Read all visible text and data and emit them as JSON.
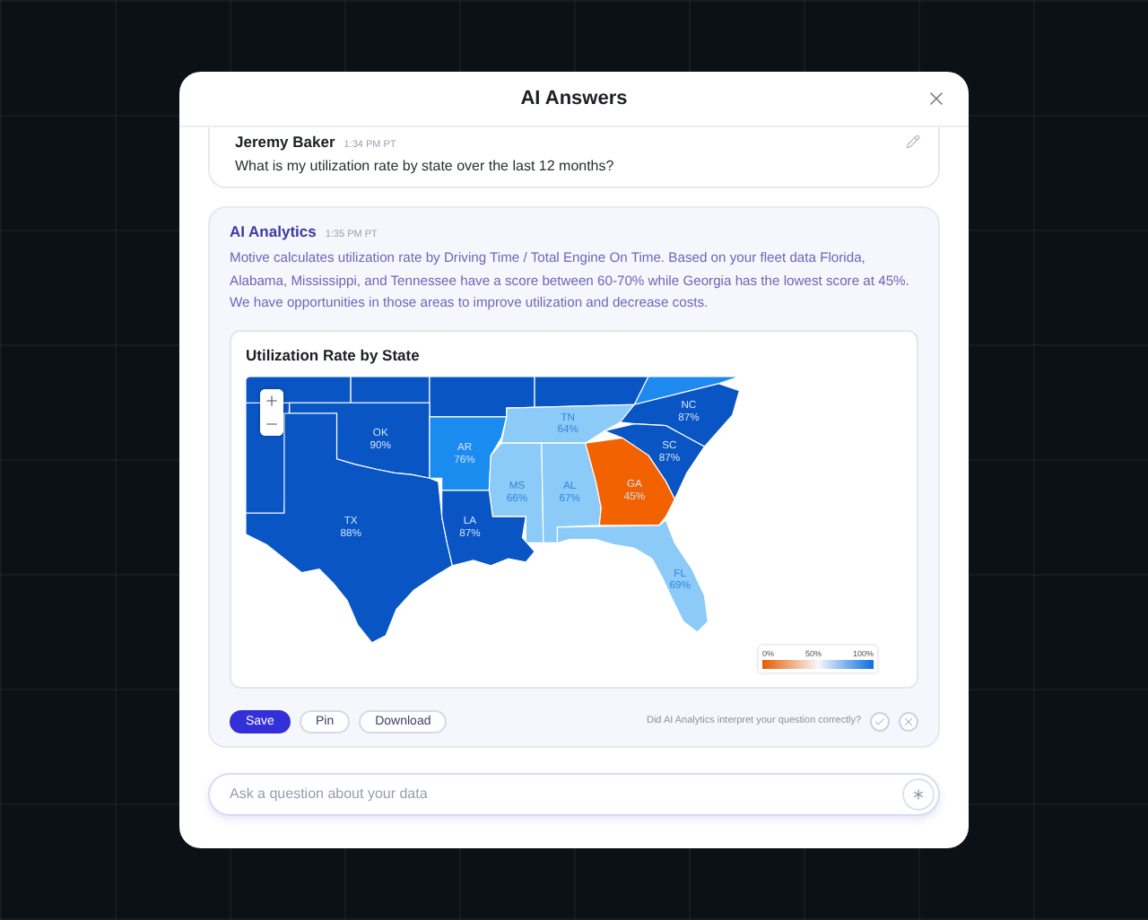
{
  "modal": {
    "title": "AI Answers"
  },
  "question": {
    "author": "Jeremy Baker",
    "time": "1:34 PM PT",
    "text": "What is my utilization rate by state over the last 12 months?"
  },
  "answer": {
    "author": "AI Analytics",
    "time": "1:35 PM PT",
    "text": "Motive calculates utilization rate by Driving Time / Total Engine On Time. Based on your fleet data Florida, Alabama, Mississippi, and Tennessee have a score between 60-70% while Georgia has the lowest score at 45%. We have opportunities in those areas to improve utilization and decrease costs.",
    "chart": {
      "title": "Utilization Rate by State",
      "states": [
        {
          "code": "OK",
          "value": "90%",
          "color": "#0a55c4"
        },
        {
          "code": "AR",
          "value": "76%",
          "color": "#1a8cf0"
        },
        {
          "code": "TN",
          "value": "64%",
          "color": "#8ccbf7"
        },
        {
          "code": "NC",
          "value": "87%",
          "color": "#0a55c4"
        },
        {
          "code": "SC",
          "value": "87%",
          "color": "#0a55c4"
        },
        {
          "code": "MS",
          "value": "66%",
          "color": "#8ccbf7"
        },
        {
          "code": "AL",
          "value": "67%",
          "color": "#8ccbf7"
        },
        {
          "code": "GA",
          "value": "45%",
          "color": "#f26200"
        },
        {
          "code": "TX",
          "value": "88%",
          "color": "#0a55c4"
        },
        {
          "code": "LA",
          "value": "87%",
          "color": "#0a55c4"
        },
        {
          "code": "FL",
          "value": "69%",
          "color": "#8ccbf7"
        }
      ],
      "legend": [
        "0%",
        "50%",
        "100%"
      ]
    },
    "actions": [
      {
        "label": "Save",
        "kind": "primary"
      },
      {
        "label": "Pin",
        "kind": "secondary"
      },
      {
        "label": "Download",
        "kind": "secondary"
      }
    ],
    "feedback": {
      "prompt": "Did AI Analytics interpret your question correctly?"
    }
  },
  "composer": {
    "placeholder": "Ask a question about your data"
  }
}
